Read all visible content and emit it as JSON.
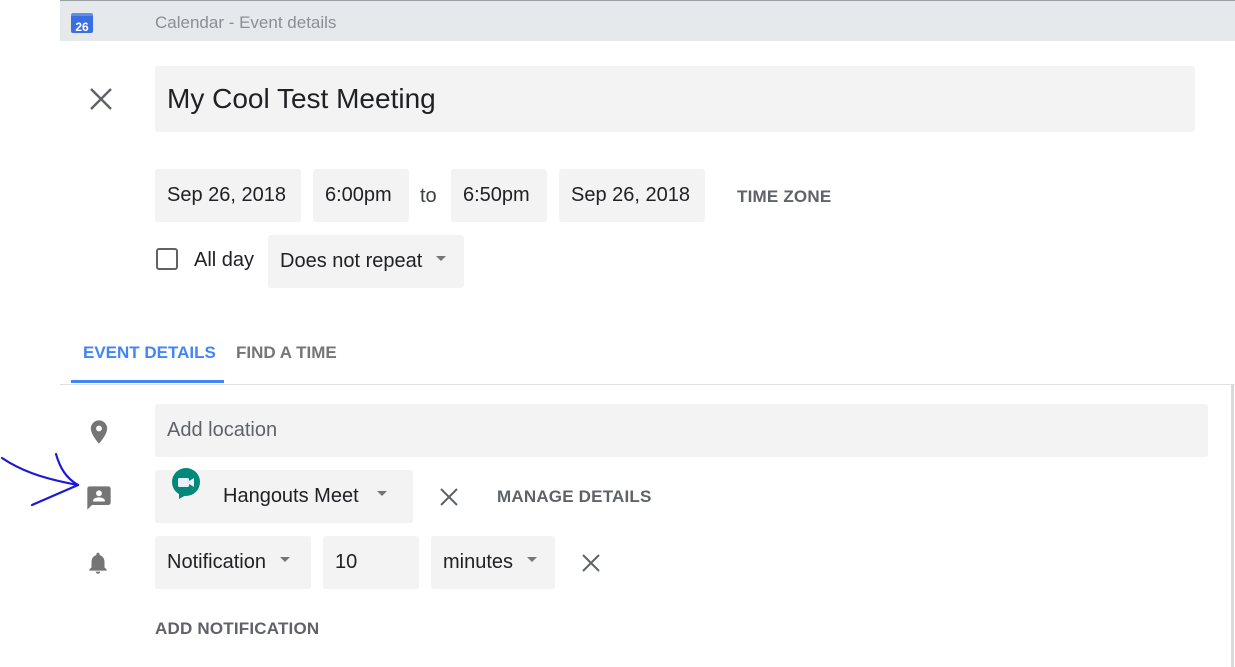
{
  "window": {
    "app_icon_day": "26",
    "title": "Calendar - Event details"
  },
  "event": {
    "title": "My Cool Test Meeting",
    "start_date": "Sep 26, 2018",
    "start_time": "6:00pm",
    "to_label": "to",
    "end_time": "6:50pm",
    "end_date": "Sep 26, 2018",
    "time_zone_label": "TIME ZONE",
    "all_day_label": "All day",
    "all_day_checked": false,
    "repeat_value": "Does not repeat"
  },
  "tabs": [
    {
      "label": "EVENT DETAILS",
      "active": true
    },
    {
      "label": "FIND A TIME",
      "active": false
    }
  ],
  "details": {
    "location_placeholder": "Add location",
    "conference_value": "Hangouts Meet",
    "manage_details_label": "MANAGE DETAILS",
    "notification_type": "Notification",
    "notification_amount": "10",
    "notification_unit": "minutes",
    "add_notification_label": "ADD NOTIFICATION"
  },
  "icons": {
    "close": "close-icon",
    "location": "location-pin-icon",
    "conference": "conference-contact-icon",
    "notification": "bell-icon",
    "meet_logo": "hangouts-meet-logo-icon",
    "annotation": "hand-drawn-arrow"
  },
  "colors": {
    "accent": "#4285f4",
    "field_bg": "#f3f3f3",
    "icon_gray": "#757575",
    "meet_green": "#00832d",
    "annotation_blue": "#1a1ad6"
  }
}
